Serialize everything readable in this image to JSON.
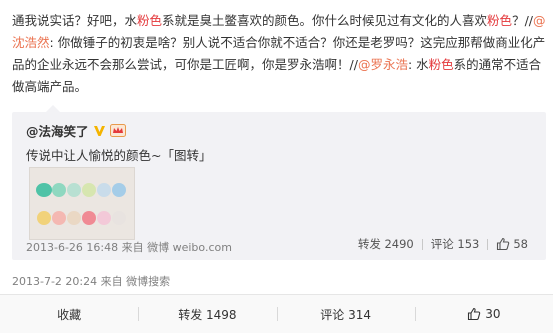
{
  "post": {
    "text_segments": [
      {
        "text": "通我说实话？好吧，水",
        "style": "normal"
      },
      {
        "text": "粉色",
        "style": "hl"
      },
      {
        "text": "系就是臭土鳖喜欢的颜色。你什么时候见过有文化的人喜欢",
        "style": "normal"
      },
      {
        "text": "粉色",
        "style": "hl"
      },
      {
        "text": "？//",
        "style": "normal"
      },
      {
        "text": "@沈浩然",
        "style": "at"
      },
      {
        "text": ": 你做锤子的初衷是啥？别人说不适合你就不适合？你还是老罗吗？这完应那帮做商业化产品的企业永远不会那么尝试，可你是工匠啊，你是罗永浩啊！//",
        "style": "normal"
      },
      {
        "text": "@罗永浩",
        "style": "at"
      },
      {
        "text": ": 水",
        "style": "normal"
      },
      {
        "text": "粉色",
        "style": "hl"
      },
      {
        "text": "系的通常不适合做高端产品。",
        "style": "normal"
      }
    ],
    "timestamp": "2013-7-2 20:24",
    "source": "来自 微博搜索",
    "meta_line": "2013-7-2 20:24 来自 微博搜索"
  },
  "quote": {
    "author": "@法海笑了",
    "text": "传说中让人愉悦的颜色~「图转」",
    "meta_line": "2013-6-26 16:48 来自 微博 weibo.com",
    "repost_label": "转发 2490",
    "comment_label": "评论 153",
    "like_count": "58"
  },
  "actions": {
    "favorite": "收藏",
    "repost": "转发 1498",
    "comment": "评论 314",
    "like": "30"
  },
  "colors": {
    "highlight": "#e4393c",
    "mention": "#eb7350",
    "quote_bg": "#f2f2f5",
    "meta": "#808080"
  },
  "icons": [
    "verified-v-icon",
    "crown-icon",
    "thumbs-up-icon"
  ]
}
